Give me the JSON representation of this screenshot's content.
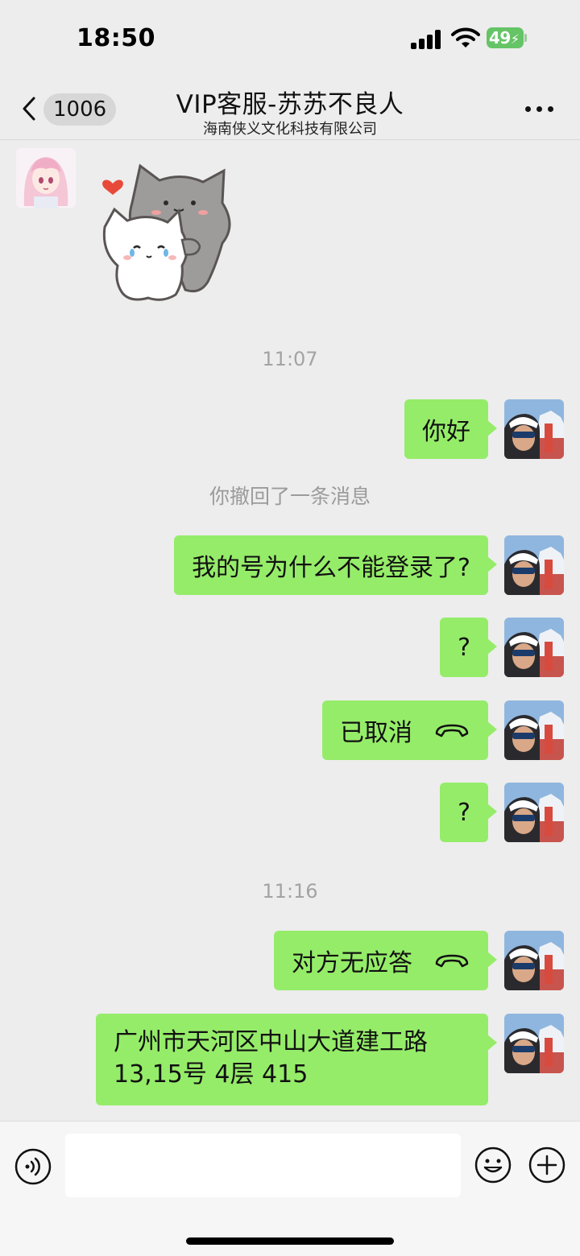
{
  "status_bar": {
    "time": "18:50",
    "battery": "49"
  },
  "header": {
    "back_icon": "chevron-left-icon",
    "unread_count": "1006",
    "title": "VIP客服-苏苏不良人",
    "subtitle": "海南侠义文化科技有限公司",
    "more_icon": "ellipsis-icon"
  },
  "chat": {
    "time_1": "11:07",
    "msg_1": "你好",
    "recall_notice": "你撤回了一条消息",
    "msg_2": "我的号为什么不能登录了?",
    "msg_3": "?",
    "msg_4": "已取消",
    "msg_5": "?",
    "time_2": "11:16",
    "msg_6": "对方无应答",
    "msg_7_line_1": "广州市天河区中山大道建工路",
    "msg_7_line_2": "13,15号 4层 415"
  },
  "input_bar": {
    "voice_icon": "voice-icon",
    "input_value": "",
    "emoji_icon": "emoji-icon",
    "plus_icon": "plus-icon"
  },
  "colors": {
    "background": "#ededed",
    "bubble_self": "#95ec69",
    "battery": "#65c466"
  }
}
